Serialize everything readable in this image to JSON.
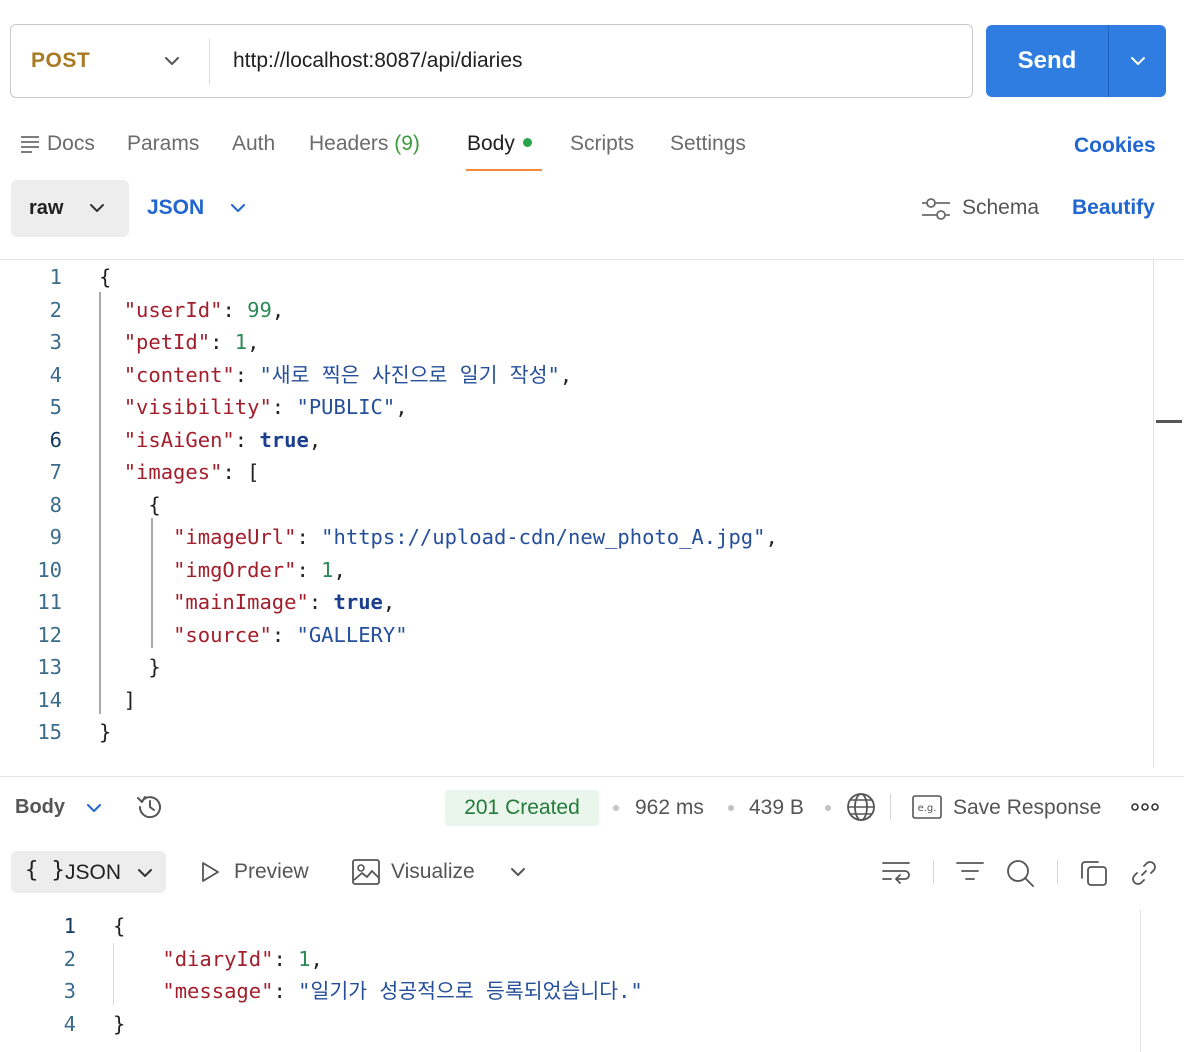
{
  "request": {
    "method": "POST",
    "url": "http://localhost:8087/api/diaries",
    "send_label": "Send"
  },
  "tabs": {
    "docs": "Docs",
    "params": "Params",
    "auth": "Auth",
    "headers": "Headers",
    "headers_count": "(9)",
    "body": "Body",
    "scripts": "Scripts",
    "settings": "Settings",
    "cookies": "Cookies",
    "active": "Body"
  },
  "body_toolbar": {
    "mode": "raw",
    "format": "JSON",
    "schema": "Schema",
    "beautify": "Beautify"
  },
  "request_body": {
    "current_line": 6,
    "lines": [
      [
        {
          "t": "{",
          "c": "p"
        }
      ],
      [
        {
          "t": "  ",
          "c": "p"
        },
        {
          "t": "\"userId\"",
          "c": "k"
        },
        {
          "t": ": ",
          "c": "p"
        },
        {
          "t": "99",
          "c": "n"
        },
        {
          "t": ",",
          "c": "p"
        }
      ],
      [
        {
          "t": "  ",
          "c": "p"
        },
        {
          "t": "\"petId\"",
          "c": "k"
        },
        {
          "t": ": ",
          "c": "p"
        },
        {
          "t": "1",
          "c": "n"
        },
        {
          "t": ",",
          "c": "p"
        }
      ],
      [
        {
          "t": "  ",
          "c": "p"
        },
        {
          "t": "\"content\"",
          "c": "k"
        },
        {
          "t": ": ",
          "c": "p"
        },
        {
          "t": "\"새로 찍은 사진으로 일기 작성\"",
          "c": "s"
        },
        {
          "t": ",",
          "c": "p"
        }
      ],
      [
        {
          "t": "  ",
          "c": "p"
        },
        {
          "t": "\"visibility\"",
          "c": "k"
        },
        {
          "t": ": ",
          "c": "p"
        },
        {
          "t": "\"PUBLIC\"",
          "c": "s"
        },
        {
          "t": ",",
          "c": "p"
        }
      ],
      [
        {
          "t": "  ",
          "c": "p"
        },
        {
          "t": "\"isAiGen\"",
          "c": "k"
        },
        {
          "t": ": ",
          "c": "p"
        },
        {
          "t": "true",
          "c": "b"
        },
        {
          "t": ",",
          "c": "p"
        }
      ],
      [
        {
          "t": "  ",
          "c": "p"
        },
        {
          "t": "\"images\"",
          "c": "k"
        },
        {
          "t": ": [",
          "c": "p"
        }
      ],
      [
        {
          "t": "    {",
          "c": "p"
        }
      ],
      [
        {
          "t": "      ",
          "c": "p"
        },
        {
          "t": "\"imageUrl\"",
          "c": "k"
        },
        {
          "t": ": ",
          "c": "p"
        },
        {
          "t": "\"https://upload-cdn/new_photo_A.jpg\"",
          "c": "s"
        },
        {
          "t": ",",
          "c": "p"
        }
      ],
      [
        {
          "t": "      ",
          "c": "p"
        },
        {
          "t": "\"imgOrder\"",
          "c": "k"
        },
        {
          "t": ": ",
          "c": "p"
        },
        {
          "t": "1",
          "c": "n"
        },
        {
          "t": ",",
          "c": "p"
        }
      ],
      [
        {
          "t": "      ",
          "c": "p"
        },
        {
          "t": "\"mainImage\"",
          "c": "k"
        },
        {
          "t": ": ",
          "c": "p"
        },
        {
          "t": "true",
          "c": "b"
        },
        {
          "t": ",",
          "c": "p"
        }
      ],
      [
        {
          "t": "      ",
          "c": "p"
        },
        {
          "t": "\"source\"",
          "c": "k"
        },
        {
          "t": ": ",
          "c": "p"
        },
        {
          "t": "\"GALLERY\"",
          "c": "s"
        }
      ],
      [
        {
          "t": "    }",
          "c": "p"
        }
      ],
      [
        {
          "t": "  ]",
          "c": "p"
        }
      ],
      [
        {
          "t": "}",
          "c": "p"
        }
      ]
    ]
  },
  "response_bar": {
    "body_label": "Body",
    "status": "201 Created",
    "time": "962 ms",
    "size": "439 B",
    "save_response": "Save Response"
  },
  "response_toolbar": {
    "format_brace": "{ }",
    "format": "JSON",
    "preview": "Preview",
    "visualize": "Visualize"
  },
  "response_body": {
    "current_line": 1,
    "lines": [
      [
        {
          "t": "{",
          "c": "p"
        }
      ],
      [
        {
          "t": "    ",
          "c": "p"
        },
        {
          "t": "\"diaryId\"",
          "c": "k"
        },
        {
          "t": ": ",
          "c": "p"
        },
        {
          "t": "1",
          "c": "n"
        },
        {
          "t": ",",
          "c": "p"
        }
      ],
      [
        {
          "t": "    ",
          "c": "p"
        },
        {
          "t": "\"message\"",
          "c": "k"
        },
        {
          "t": ": ",
          "c": "p"
        },
        {
          "t": "\"일기가 성공적으로 등록되었습니다.\"",
          "c": "s"
        }
      ],
      [
        {
          "t": "}",
          "c": "p"
        }
      ]
    ]
  },
  "colors": {
    "method": "#a87a24",
    "send": "#2f7de1",
    "link": "#2166d1",
    "tab_underline": "#f08a3c",
    "status_bg": "#eaf6ec",
    "status_text": "#247a3a"
  }
}
